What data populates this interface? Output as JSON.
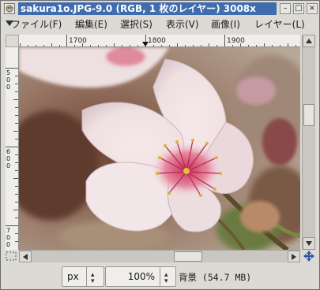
{
  "window": {
    "title": "sakura1o.JPG-9.0 (RGB, 1 枚のレイヤー) 3008x",
    "minimize_symbol": "–",
    "maximize_symbol": "□",
    "close_symbol": "×"
  },
  "menu": {
    "items": [
      "ファイル(F)",
      "編集(E)",
      "選択(S)",
      "表示(V)",
      "画像(I)",
      "レイヤー(L)"
    ]
  },
  "rulers": {
    "horizontal_labels": [
      "1700",
      "1800",
      "1900"
    ],
    "vertical_labels": [
      "500",
      "600",
      "700"
    ]
  },
  "status": {
    "unit": "px",
    "zoom": "100%",
    "layer_info": "背景 (54.7 MB)"
  },
  "colors": {
    "title_active": "#3f6cae",
    "petal": "#f0e3e3",
    "background_blur": "#8a6a5a"
  },
  "icons": [
    "app-icon",
    "menu-arrow-icon",
    "navigate-icon",
    "quick-mask-icon"
  ]
}
